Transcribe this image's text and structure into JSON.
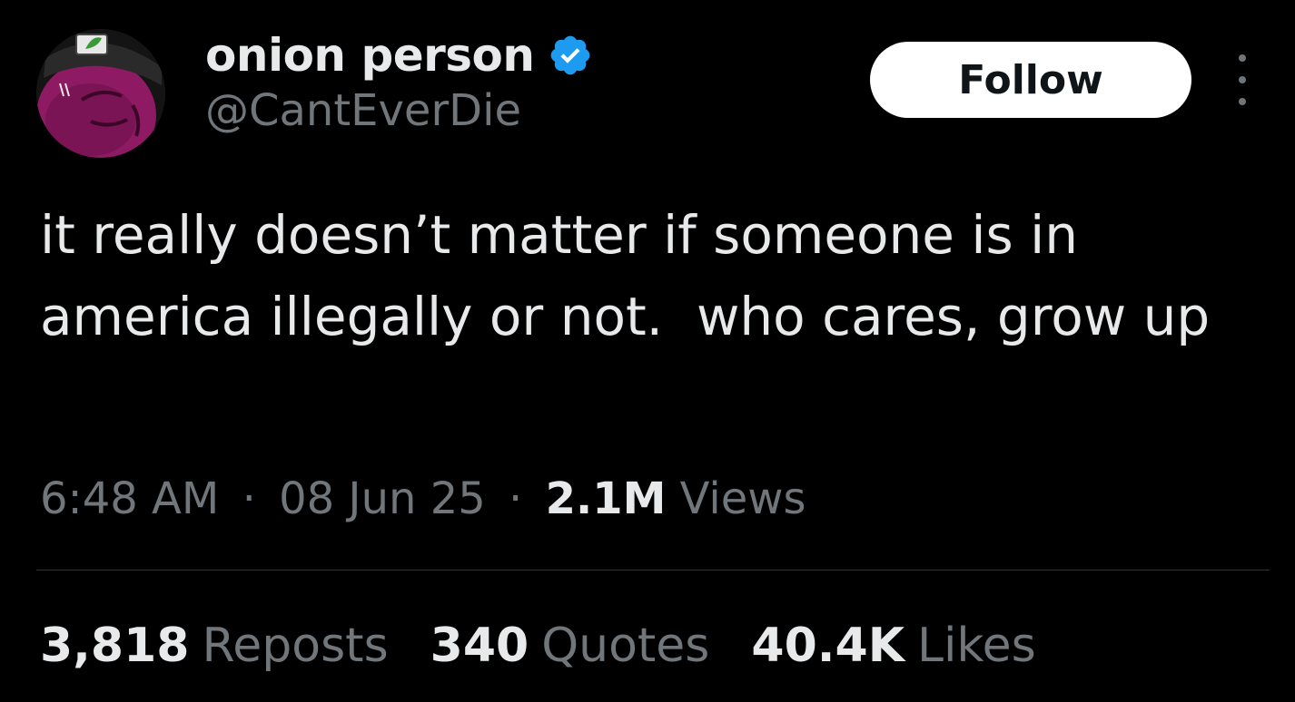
{
  "user": {
    "display_name": "onion person",
    "handle": "@CantEverDie",
    "verified": true,
    "avatar_icon": "onion-avatar-icon",
    "verified_icon": "verified-badge-icon",
    "accent_color": "#1d9bf0"
  },
  "actions": {
    "follow_label": "Follow",
    "more_icon": "more-vertical-icon"
  },
  "tweet": {
    "text": "it really doesn’t matter if someone is in america illegally or not.  who cares, grow up"
  },
  "meta": {
    "time": "6:48 AM",
    "separator": "·",
    "date": "08 Jun 25",
    "views_count": "2.1M",
    "views_label": "Views"
  },
  "stats": {
    "reposts_count": "3,818",
    "reposts_label": "Reposts",
    "quotes_count": "340",
    "quotes_label": "Quotes",
    "likes_count": "40.4K",
    "likes_label": "Likes"
  },
  "colors": {
    "background": "#000000",
    "primary_text": "#e7e9ea",
    "secondary_text": "#71767b",
    "divider": "#2f3336",
    "follow_bg": "#ffffff",
    "follow_text": "#0f1419"
  }
}
